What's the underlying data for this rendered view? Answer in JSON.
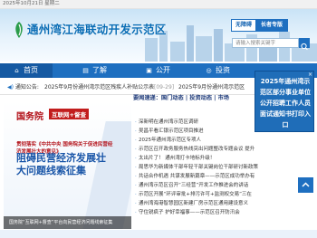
{
  "topbar": {
    "date": "2025年10月21日 星期二"
  },
  "header": {
    "site_title": "通州湾江海联动开发示范区",
    "accessibility_label": "无障碍",
    "elderly_label": "长者专版",
    "search_placeholder": "请输入搜索关键字"
  },
  "nav": {
    "items": [
      {
        "label": "首页",
        "icon": "home-icon"
      },
      {
        "label": "了解",
        "icon": "book-icon"
      },
      {
        "label": "公开",
        "icon": "document-icon"
      },
      {
        "label": "投资",
        "icon": "invest-icon"
      }
    ]
  },
  "notice": {
    "label": "通知公告",
    "item1_text": "2025年9月份通州湾示范区残疾人补贴公示表",
    "item1_date": "[09-29]",
    "item2_text": "2025年9月份通州湾示范区"
  },
  "popup": {
    "text": "2025年通州湾示范区部分事业单位公开招聘工作人员面试通知书打印入口",
    "close": "×"
  },
  "slide": {
    "org": "国务院",
    "tag": "互联网+督查",
    "subtitle": "贯彻落实《中共中央 国务院关于促进民营经济发展壮大的意见》",
    "headline": "阻碍民营经济发展壮大问题线索征集",
    "caption": "国务院“互联网+督查”平台向民营经济问题线索征集"
  },
  "news": {
    "headline": "要闻速递：国门动态 | 投资动态 | 市场",
    "items": [
      "深新明在通州湾示范区调研",
      "吴昌平看汇银示范区项目推进",
      "2025年通州湾示范区专项人",
      "示范区召开政务服务热线突出问题整改专题会议 提升",
      "太出片了！ 通州湾打卡地标升级！",
      "局思华为新媒体干部年轻干部关键岗位干部研讨新政策",
      "共话合作机遇 共谋发展新篇章——示范区成功举办有",
      "通州湾示范区召开“三经营”开发工作推进会的讲话",
      "示范区开展“环评审批+排污许可+监测权交易”三在",
      "通州湾海港智慧园区新建厂房示范区通用建设意义",
      "守住锐疯子 护好幸福事——示范区召开防汛会"
    ]
  },
  "colors": {
    "primary": "#1e6fc0",
    "nav_active": "#1559a2",
    "popup": "#1f6db8",
    "slide_red": "#b3121a",
    "slide_blue": "#1a56a8"
  }
}
